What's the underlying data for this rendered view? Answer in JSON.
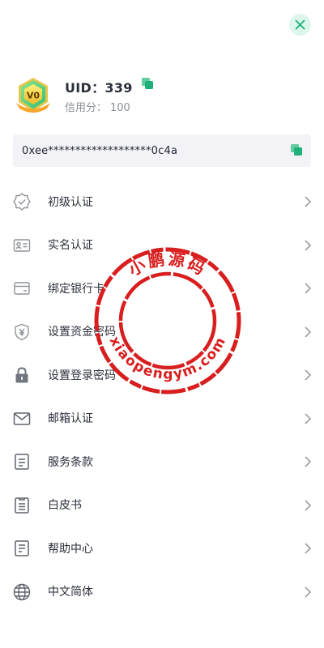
{
  "header": {
    "level_badge": "V0",
    "uid_label": "UID：339",
    "credit_label": "信用分：",
    "credit_value": "100",
    "copy_icon": "copy-icon"
  },
  "address": {
    "value": "0xee*******************0c4a",
    "copy_icon": "copy-icon"
  },
  "menu": [
    {
      "label": "初级认证",
      "icon": "verified-badge-icon"
    },
    {
      "label": "实名认证",
      "icon": "id-card-icon"
    },
    {
      "label": "绑定银行卡",
      "icon": "bank-card-icon"
    },
    {
      "label": "设置资金密码",
      "icon": "fund-shield-icon"
    },
    {
      "label": "设置登录密码",
      "icon": "lock-icon"
    },
    {
      "label": "邮箱认证",
      "icon": "mail-icon"
    },
    {
      "label": "服务条款",
      "icon": "document-icon"
    },
    {
      "label": "白皮书",
      "icon": "whitepaper-icon"
    },
    {
      "label": "帮助中心",
      "icon": "help-document-icon"
    },
    {
      "label": "中文简体",
      "icon": "globe-icon"
    }
  ],
  "watermark": {
    "top_text": "小鹏源码",
    "bottom_text": "xiaopengym.com"
  },
  "colors": {
    "accent": "#1fb07a",
    "close_bg": "#dcf6ec",
    "stamp_red": "#d81e1e",
    "address_bg": "#f2f2f7"
  }
}
